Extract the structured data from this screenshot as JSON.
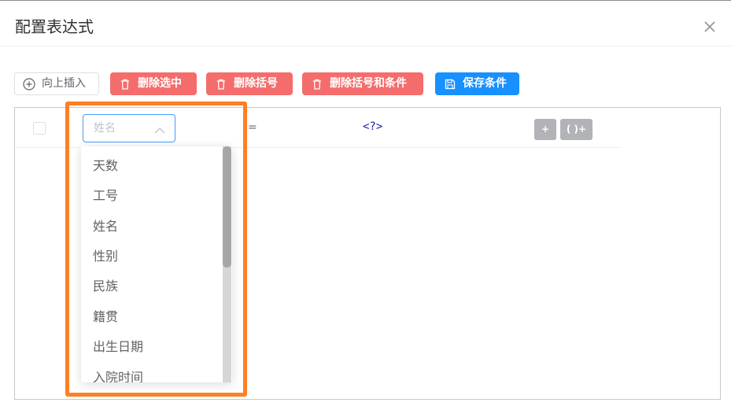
{
  "dialog": {
    "title": "配置表达式",
    "close_icon": "close-icon"
  },
  "toolbar": {
    "insert_above": {
      "label": "向上插入",
      "icon": "plus-circle-icon"
    },
    "delete_selected": {
      "label": "删除选中",
      "icon": "trash-icon"
    },
    "delete_brackets": {
      "label": "删除括号",
      "icon": "trash-icon"
    },
    "delete_brackets_conditions": {
      "label": "删除括号和条件",
      "icon": "trash-icon"
    },
    "save_conditions": {
      "label": "保存条件",
      "icon": "save-icon"
    }
  },
  "condition_row": {
    "field_value": "姓名",
    "operator": "=",
    "value_placeholder": "<?>",
    "add_button": "+",
    "add_bracket_button": "( )+"
  },
  "field_dropdown": {
    "options": [
      "天数",
      "工号",
      "姓名",
      "性别",
      "民族",
      "籍贯",
      "出生日期",
      "入院时间"
    ]
  },
  "colors": {
    "danger": "#f56c6c",
    "primary": "#1890ff",
    "highlight": "#ff7f24",
    "mini_button": "#b1b3b8"
  }
}
